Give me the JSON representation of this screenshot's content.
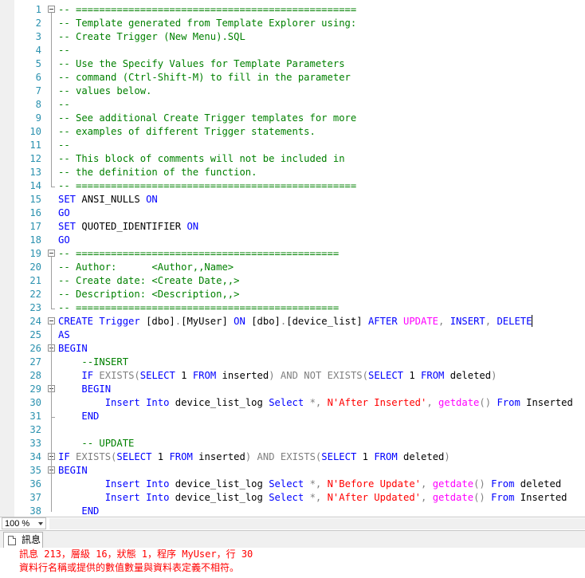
{
  "editor": {
    "lines": [
      {
        "n": "1",
        "fold": "start",
        "tokens": [
          [
            "c",
            "-- ================================================"
          ]
        ]
      },
      {
        "n": "2",
        "tokens": [
          [
            "c",
            "-- Template generated from Template Explorer using:"
          ]
        ]
      },
      {
        "n": "3",
        "tokens": [
          [
            "c",
            "-- Create Trigger (New Menu).SQL"
          ]
        ]
      },
      {
        "n": "4",
        "tokens": [
          [
            "c",
            "--"
          ]
        ]
      },
      {
        "n": "5",
        "tokens": [
          [
            "c",
            "-- Use the Specify Values for Template Parameters"
          ]
        ]
      },
      {
        "n": "6",
        "tokens": [
          [
            "c",
            "-- command (Ctrl-Shift-M) to fill in the parameter"
          ]
        ]
      },
      {
        "n": "7",
        "tokens": [
          [
            "c",
            "-- values below."
          ]
        ]
      },
      {
        "n": "8",
        "tokens": [
          [
            "c",
            "--"
          ]
        ]
      },
      {
        "n": "9",
        "tokens": [
          [
            "c",
            "-- See additional Create Trigger templates for more"
          ]
        ]
      },
      {
        "n": "10",
        "tokens": [
          [
            "c",
            "-- examples of different Trigger statements."
          ]
        ]
      },
      {
        "n": "11",
        "tokens": [
          [
            "c",
            "--"
          ]
        ]
      },
      {
        "n": "12",
        "tokens": [
          [
            "c",
            "-- This block of comments will not be included in"
          ]
        ]
      },
      {
        "n": "13",
        "tokens": [
          [
            "c",
            "-- the definition of the function."
          ]
        ]
      },
      {
        "n": "14",
        "fold": "end",
        "tokens": [
          [
            "c",
            "-- ================================================"
          ]
        ]
      },
      {
        "n": "15",
        "tokens": [
          [
            "k",
            "SET"
          ],
          [
            "t",
            " ANSI_NULLS "
          ],
          [
            "k",
            "ON"
          ]
        ]
      },
      {
        "n": "16",
        "tokens": [
          [
            "k",
            "GO"
          ]
        ]
      },
      {
        "n": "17",
        "tokens": [
          [
            "k",
            "SET"
          ],
          [
            "t",
            " QUOTED_IDENTIFIER "
          ],
          [
            "k",
            "ON"
          ]
        ]
      },
      {
        "n": "18",
        "tokens": [
          [
            "k",
            "GO"
          ]
        ]
      },
      {
        "n": "19",
        "fold": "start",
        "tokens": [
          [
            "c",
            "-- ============================================="
          ]
        ]
      },
      {
        "n": "20",
        "tokens": [
          [
            "c",
            "-- Author:      <Author,,Name>"
          ]
        ]
      },
      {
        "n": "21",
        "tokens": [
          [
            "c",
            "-- Create date: <Create Date,,>"
          ]
        ]
      },
      {
        "n": "22",
        "tokens": [
          [
            "c",
            "-- Description: <Description,,>"
          ]
        ]
      },
      {
        "n": "23",
        "fold": "end",
        "tokens": [
          [
            "c",
            "-- ============================================="
          ]
        ]
      },
      {
        "n": "24",
        "fold": "start",
        "tokens": [
          [
            "k",
            "CREATE"
          ],
          [
            "t",
            " "
          ],
          [
            "k",
            "Trigger"
          ],
          [
            "t",
            " [dbo]"
          ],
          [
            "p",
            "."
          ],
          [
            "t",
            "[MyUser] "
          ],
          [
            "k",
            "ON"
          ],
          [
            "t",
            " [dbo]"
          ],
          [
            "p",
            "."
          ],
          [
            "t",
            "[device_list] "
          ],
          [
            "k",
            "AFTER"
          ],
          [
            "t",
            " "
          ],
          [
            "f",
            "UPDATE"
          ],
          [
            "p",
            ","
          ],
          [
            "t",
            " "
          ],
          [
            "k",
            "INSERT"
          ],
          [
            "p",
            ","
          ],
          [
            "t",
            " "
          ],
          [
            "k",
            "DELETE"
          ],
          [
            "caret",
            ""
          ]
        ]
      },
      {
        "n": "25",
        "tokens": [
          [
            "k",
            "AS"
          ]
        ]
      },
      {
        "n": "26",
        "fold": "start",
        "tokens": [
          [
            "k",
            "BEGIN"
          ]
        ]
      },
      {
        "n": "27",
        "tokens": [
          [
            "t",
            "    "
          ],
          [
            "c",
            "--INSERT"
          ]
        ]
      },
      {
        "n": "28",
        "tokens": [
          [
            "t",
            "    "
          ],
          [
            "k",
            "IF"
          ],
          [
            "t",
            " "
          ],
          [
            "p",
            "EXISTS("
          ],
          [
            "k",
            "SELECT"
          ],
          [
            "t",
            " 1 "
          ],
          [
            "k",
            "FROM"
          ],
          [
            "t",
            " inserted"
          ],
          [
            "p",
            ")"
          ],
          [
            "t",
            " "
          ],
          [
            "p",
            "AND"
          ],
          [
            "t",
            " "
          ],
          [
            "p",
            "NOT"
          ],
          [
            "t",
            " "
          ],
          [
            "p",
            "EXISTS("
          ],
          [
            "k",
            "SELECT"
          ],
          [
            "t",
            " 1 "
          ],
          [
            "k",
            "FROM"
          ],
          [
            "t",
            " deleted"
          ],
          [
            "p",
            ")"
          ]
        ]
      },
      {
        "n": "29",
        "fold": "start",
        "tokens": [
          [
            "t",
            "    "
          ],
          [
            "k",
            "BEGIN"
          ]
        ]
      },
      {
        "n": "30",
        "tokens": [
          [
            "t",
            "        "
          ],
          [
            "k",
            "Insert"
          ],
          [
            "t",
            " "
          ],
          [
            "k",
            "Into"
          ],
          [
            "t",
            " device_list_log "
          ],
          [
            "k",
            "Select"
          ],
          [
            "t",
            " "
          ],
          [
            "p",
            "*,"
          ],
          [
            "t",
            " "
          ],
          [
            "s",
            "N'After Inserted'"
          ],
          [
            "p",
            ","
          ],
          [
            "t",
            " "
          ],
          [
            "f",
            "getdate"
          ],
          [
            "p",
            "()"
          ],
          [
            "t",
            " "
          ],
          [
            "k",
            "From"
          ],
          [
            "t",
            " Inserted"
          ]
        ]
      },
      {
        "n": "31",
        "fold": "end",
        "tokens": [
          [
            "t",
            "    "
          ],
          [
            "k",
            "END"
          ]
        ]
      },
      {
        "n": "32",
        "tokens": []
      },
      {
        "n": "33",
        "tokens": [
          [
            "t",
            "    "
          ],
          [
            "c",
            "-- UPDATE"
          ]
        ]
      },
      {
        "n": "34",
        "fold": "start",
        "tokens": [
          [
            "k",
            "IF"
          ],
          [
            "t",
            " "
          ],
          [
            "p",
            "EXISTS("
          ],
          [
            "k",
            "SELECT"
          ],
          [
            "t",
            " 1 "
          ],
          [
            "k",
            "FROM"
          ],
          [
            "t",
            " inserted"
          ],
          [
            "p",
            ")"
          ],
          [
            "t",
            " "
          ],
          [
            "p",
            "AND"
          ],
          [
            "t",
            " "
          ],
          [
            "p",
            "EXISTS("
          ],
          [
            "k",
            "SELECT"
          ],
          [
            "t",
            " 1 "
          ],
          [
            "k",
            "FROM"
          ],
          [
            "t",
            " deleted"
          ],
          [
            "p",
            ")"
          ]
        ]
      },
      {
        "n": "35",
        "fold": "start",
        "tokens": [
          [
            "k",
            "BEGIN"
          ]
        ]
      },
      {
        "n": "36",
        "tokens": [
          [
            "t",
            "        "
          ],
          [
            "k",
            "Insert"
          ],
          [
            "t",
            " "
          ],
          [
            "k",
            "Into"
          ],
          [
            "t",
            " device_list_log "
          ],
          [
            "k",
            "Select"
          ],
          [
            "t",
            " "
          ],
          [
            "p",
            "*,"
          ],
          [
            "t",
            " "
          ],
          [
            "s",
            "N'Before Update'"
          ],
          [
            "p",
            ","
          ],
          [
            "t",
            " "
          ],
          [
            "f",
            "getdate"
          ],
          [
            "p",
            "()"
          ],
          [
            "t",
            " "
          ],
          [
            "k",
            "From"
          ],
          [
            "t",
            " deleted"
          ]
        ]
      },
      {
        "n": "37",
        "tokens": [
          [
            "t",
            "        "
          ],
          [
            "k",
            "Insert"
          ],
          [
            "t",
            " "
          ],
          [
            "k",
            "Into"
          ],
          [
            "t",
            " device_list_log "
          ],
          [
            "k",
            "Select"
          ],
          [
            "t",
            " "
          ],
          [
            "p",
            "*,"
          ],
          [
            "t",
            " "
          ],
          [
            "s",
            "N'After Updated'"
          ],
          [
            "p",
            ","
          ],
          [
            "t",
            " "
          ],
          [
            "f",
            "getdate"
          ],
          [
            "p",
            "()"
          ],
          [
            "t",
            " "
          ],
          [
            "k",
            "From"
          ],
          [
            "t",
            " Inserted"
          ]
        ]
      },
      {
        "n": "38",
        "tokens": [
          [
            "t",
            "    "
          ],
          [
            "k",
            "END"
          ]
        ]
      }
    ]
  },
  "statusbar": {
    "zoom": "100 %"
  },
  "results": {
    "tab_label": "訊息",
    "messages": [
      "訊息 213，層級 16，狀態 1，程序 MyUser，行 30",
      "資料行名稱或提供的數值數量與資料表定義不相符。"
    ]
  }
}
